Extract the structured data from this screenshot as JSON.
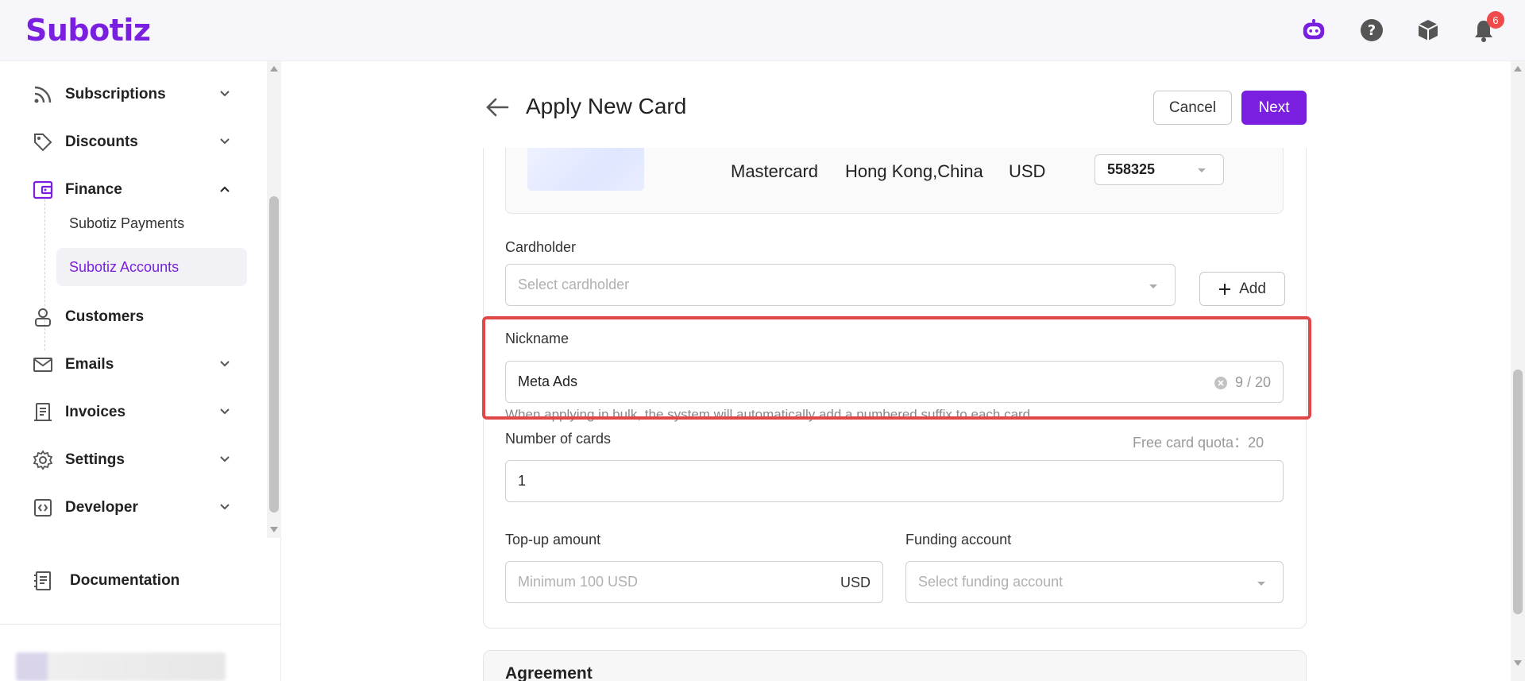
{
  "header": {
    "logo": "Subotiz",
    "notifications_count": "6"
  },
  "sidebar": {
    "items": [
      {
        "label": "Subscriptions"
      },
      {
        "label": "Discounts"
      },
      {
        "label": "Finance"
      },
      {
        "label": "Customers"
      },
      {
        "label": "Emails"
      },
      {
        "label": "Invoices"
      },
      {
        "label": "Settings"
      },
      {
        "label": "Developer"
      },
      {
        "label": "Documentation"
      }
    ],
    "finance_sub": [
      {
        "label": "Subotiz Payments"
      },
      {
        "label": "Subotiz Accounts"
      }
    ],
    "active_sub": "Subotiz Accounts"
  },
  "page": {
    "title": "Apply New Card",
    "cancel_label": "Cancel",
    "next_label": "Next"
  },
  "card": {
    "network": "Mastercard",
    "region": "Hong Kong,China",
    "currency": "USD",
    "bin_selected": "558325"
  },
  "form": {
    "cardholder_label": "Cardholder",
    "cardholder_placeholder": "Select cardholder",
    "add_label": "Add",
    "nickname_label": "Nickname",
    "nickname_value": "Meta Ads",
    "nickname_counter": "9 / 20",
    "nickname_hint": "When applying in bulk, the system will automatically add a numbered suffix to each card",
    "number_label": "Number of cards",
    "quota_text": "Free card quota：20",
    "number_value": "1",
    "topup_label": "Top-up amount",
    "topup_placeholder": "Minimum 100 USD",
    "topup_suffix": "USD",
    "funding_label": "Funding account",
    "funding_placeholder": "Select funding account"
  },
  "agreement": {
    "title": "Agreement"
  },
  "colors": {
    "brand": "#7a1fe0",
    "highlight": "#e04848",
    "badge": "#f04b4b"
  }
}
